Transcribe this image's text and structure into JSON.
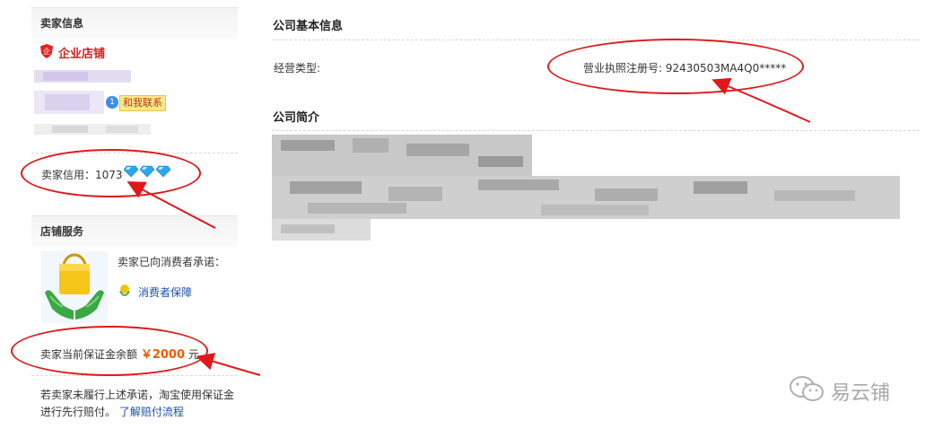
{
  "seller": {
    "heading": "卖家信息",
    "shop_type": "企业店铺",
    "contact_label": "和我联系",
    "credit_label": "卖家信用：",
    "credit_value": "1073"
  },
  "service": {
    "heading": "店铺服务",
    "promise_text": "卖家已向消费者承诺：",
    "guarantee_label": "消费者保障",
    "deposit_label": "卖家当前保证金余额",
    "deposit_amount": "￥2000",
    "deposit_unit": "元",
    "note_line1": "若卖家未履行上述承诺，淘宝使用保证金",
    "note_line2": "进行先行赔付。",
    "note_link": "了解赔付流程"
  },
  "company": {
    "basic_title": "公司基本信息",
    "business_type_label": "经营类型:",
    "license_label": "营业执照注册号:",
    "license_value": "92430503MA4Q0*****",
    "intro_title": "公司简介"
  },
  "watermark": {
    "text": "易云铺"
  },
  "colors": {
    "annotation_red": "#e0181a",
    "link_blue": "#1b4fa8",
    "price_orange": "#f35a00",
    "diamond_blue": "#2ea7e8"
  }
}
